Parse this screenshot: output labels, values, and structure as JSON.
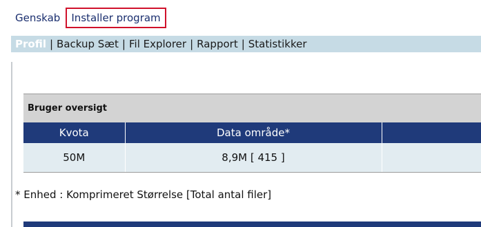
{
  "topnav": {
    "items": [
      {
        "label": "Genskab"
      },
      {
        "label": "Installer program"
      }
    ]
  },
  "subnav": {
    "items": [
      {
        "label": "Profil"
      },
      {
        "label": "Backup Sæt"
      },
      {
        "label": "Fil Explorer"
      },
      {
        "label": "Rapport"
      },
      {
        "label": "Statistikker"
      }
    ],
    "separator": "|"
  },
  "user_overview": {
    "title": "Bruger oversigt",
    "columns": [
      "Kvota",
      "Data område*",
      ""
    ],
    "rows": [
      [
        "50M",
        "8,9M [ 415 ]",
        ""
      ]
    ],
    "footnote": "* Enhed : Komprimeret Størrelse [Total antal filer]"
  },
  "colors": {
    "header_blue": "#1f3a7a",
    "subnav_bg": "#c6dbe5",
    "active_border": "#d0102a"
  }
}
